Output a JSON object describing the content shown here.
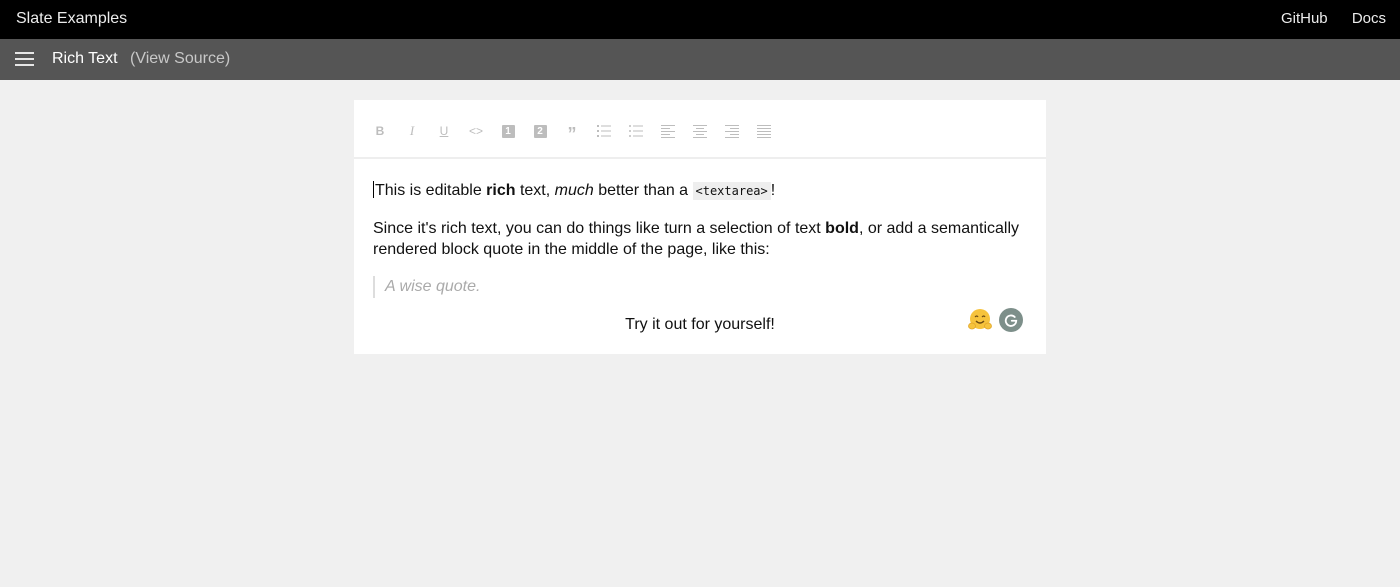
{
  "topbar": {
    "title": "Slate Examples",
    "links": [
      "GitHub",
      "Docs"
    ]
  },
  "subbar": {
    "menu_icon": "hamburger-menu-icon",
    "example_title": "Rich Text",
    "view_source": "(View Source)"
  },
  "toolbar": {
    "buttons": [
      {
        "name": "bold",
        "icon": "bold-icon",
        "glyph": "B"
      },
      {
        "name": "italic",
        "icon": "italic-icon",
        "glyph": "I"
      },
      {
        "name": "underline",
        "icon": "underline-icon",
        "glyph": "U"
      },
      {
        "name": "code",
        "icon": "code-icon",
        "glyph": "<>"
      },
      {
        "name": "heading-one",
        "icon": "heading-one-icon",
        "glyph": "1"
      },
      {
        "name": "heading-two",
        "icon": "heading-two-icon",
        "glyph": "2"
      },
      {
        "name": "block-quote",
        "icon": "quote-icon",
        "glyph": "”"
      },
      {
        "name": "numbered-list",
        "icon": "numbered-list-icon"
      },
      {
        "name": "bulleted-list",
        "icon": "bulleted-list-icon"
      },
      {
        "name": "align-left",
        "icon": "align-left-icon"
      },
      {
        "name": "align-center",
        "icon": "align-center-icon"
      },
      {
        "name": "align-right",
        "icon": "align-right-icon"
      },
      {
        "name": "align-justify",
        "icon": "align-justify-icon"
      }
    ]
  },
  "content": {
    "para1": {
      "t1": "This is editable ",
      "bold": "rich",
      "t2": " text, ",
      "italic": "much",
      "t3": " better than a ",
      "code": "<textarea>",
      "t4": "!"
    },
    "para2": {
      "t1": "Since it's rich text, you can do things like turn a selection of text ",
      "bold": "bold",
      "t2": ", or add a semantically rendered block quote in the middle of the page, like this:"
    },
    "quote": "A wise quote.",
    "para3": "Try it out for yourself!"
  },
  "extensions": {
    "emoji_icon": "hugging-face-icon",
    "grammarly_icon": "grammarly-icon"
  },
  "colors": {
    "topbar": "#000000",
    "subbar": "#555555",
    "background": "#f0f0f0",
    "toolbar_icons": "#bdbdbd"
  }
}
